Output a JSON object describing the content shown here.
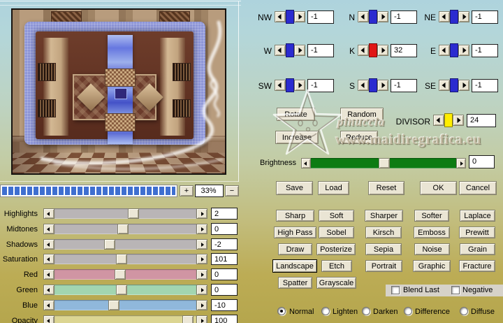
{
  "zoom_control": {
    "zoom_in": "+",
    "level": "33%",
    "zoom_out": "−"
  },
  "adjustments": [
    {
      "label": "Highlights",
      "value": "2",
      "track": "#b9b5b6"
    },
    {
      "label": "Midtones",
      "value": "0",
      "track": "#b9b5b6"
    },
    {
      "label": "Shadows",
      "value": "-2",
      "track": "#b9b5b6"
    },
    {
      "label": "Saturation",
      "value": "101",
      "track": "#b9b5b6"
    },
    {
      "label": "Red",
      "value": "0",
      "track": "#d095a3"
    },
    {
      "label": "Green",
      "value": "0",
      "track": "#a2d5b0"
    },
    {
      "label": "Blue",
      "value": "-10",
      "track": "#90b8db"
    },
    {
      "label": "Opacity",
      "value": "100",
      "track": "#dcd592"
    }
  ],
  "matrix_cells": [
    {
      "label": "NW",
      "value": "-1"
    },
    {
      "label": "N",
      "value": "-1"
    },
    {
      "label": "NE",
      "value": "-1"
    },
    {
      "label": "W",
      "value": "-1"
    },
    {
      "label": "K",
      "value": "32"
    },
    {
      "label": "E",
      "value": "-1"
    },
    {
      "label": "SW",
      "value": "-1"
    },
    {
      "label": "S",
      "value": "-1"
    },
    {
      "label": "SE",
      "value": "-1"
    }
  ],
  "divisor": {
    "label": "DIVISOR",
    "value": "24"
  },
  "action_buttons": {
    "rotate": "Rotate",
    "random": "Random",
    "increase": "Increase",
    "reduce": "Reduce"
  },
  "brightness": {
    "label": "Brightness",
    "value": "0"
  },
  "file_buttons": {
    "save": "Save",
    "load": "Load",
    "reset": "Reset",
    "ok": "OK",
    "cancel": "Cancel"
  },
  "preset_buttons": [
    "Sharp",
    "Soft",
    "Sharper",
    "Softer",
    "Laplace",
    "High Pass",
    "Sobel",
    "Kirsch",
    "Emboss",
    "Prewitt",
    "Draw",
    "Posterize",
    "Sepia",
    "Noise",
    "Grain",
    "Landscape",
    "Etch",
    "Portrait",
    "Graphic",
    "Fracture",
    "Spatter",
    "Grayscale"
  ],
  "blend_checkboxes": [
    {
      "label": "Blend Last",
      "checked": false
    },
    {
      "label": "Negative",
      "checked": false
    }
  ],
  "blend_modes": {
    "options": [
      "Normal",
      "Lighten",
      "Darken",
      "Difference",
      "Diffuse"
    ],
    "selected": "Normal"
  },
  "watermark": {
    "name": "pinuccia",
    "site": "www.maidiregrafica.eu"
  },
  "colors": {
    "matrix_thumb": "#2b2bd0",
    "k_thumb": "#e01616",
    "divisor_thumb": "#ffee00",
    "brightness_track": "#0d7c12",
    "zoom_segments": "#3f6fd0"
  }
}
